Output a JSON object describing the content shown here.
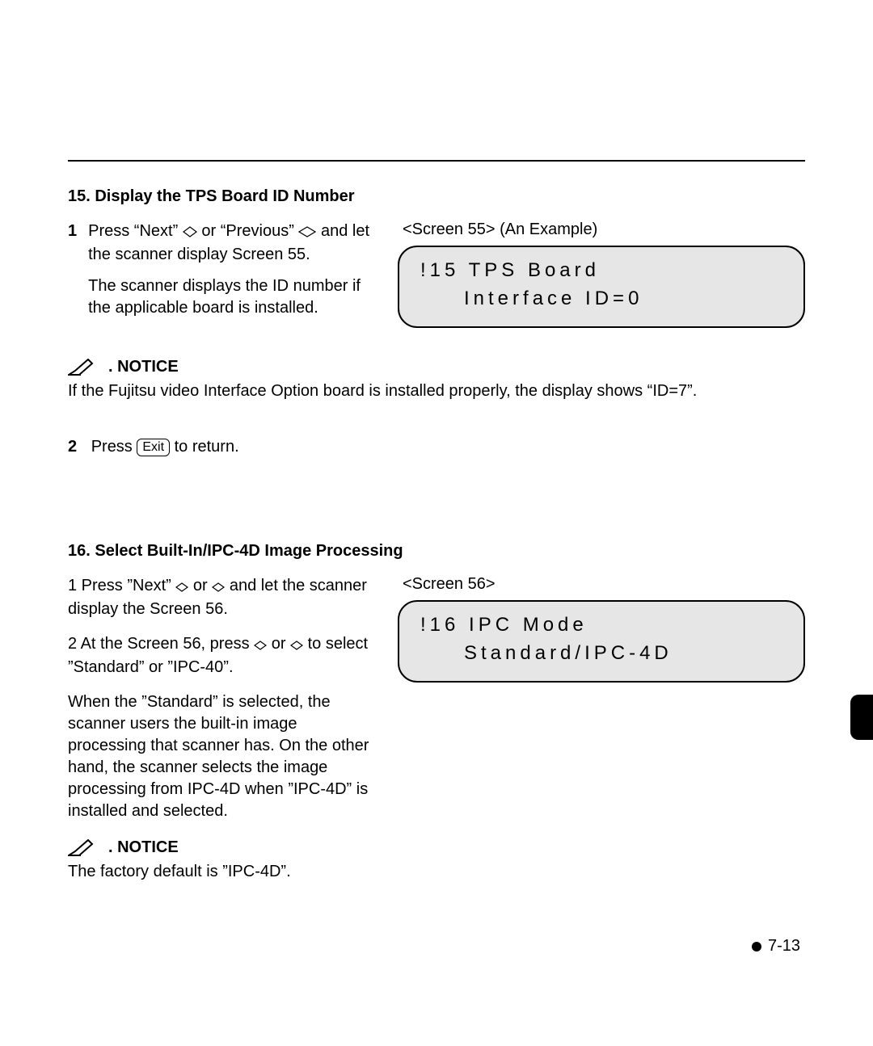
{
  "section15": {
    "heading": "15. Display the TPS Board ID Number",
    "step1_num": "1",
    "step1_a": "Press “Next” ",
    "step1_b": " or “Previous” ",
    "step1_c": " and let the scanner display Screen 55.",
    "step1_extra": "The scanner displays the ID number if the applicable board is installed.",
    "screen_label": "<Screen 55> (An Example)",
    "lcd_line1": "!15 TPS Board",
    "lcd_line2": "Interface ID=0",
    "notice_label": ". NOTICE",
    "notice_body": "If the Fujitsu video Interface Option board is installed properly, the display shows “ID=7”.",
    "step2_num": "2",
    "step2_a": "Press ",
    "step2_key": "Exit",
    "step2_b": " to return."
  },
  "section16": {
    "heading": "16. Select Built-In/IPC-4D Image Processing",
    "screen_label": "<Screen 56>",
    "para1_a": "1 Press ”Next” ",
    "para1_b": " or ",
    "para1_c": " and let the scanner display the Screen 56.",
    "para2_a": "2 At the Screen 56, press ",
    "para2_b": " or ",
    "para2_c": " to select ”Standard” or ”IPC-40”.",
    "para3": "When the ”Standard” is selected, the scanner users the built-in image processing that scanner has.  On the other hand, the scanner selects the image processing from IPC-4D when ”IPC-4D” is installed and selected.",
    "lcd_line1": "!16 IPC Mode",
    "lcd_line2": "Standard/IPC-4D",
    "notice_label": ". NOTICE",
    "notice_body": "The factory default is ”IPC-4D”."
  },
  "page_number": "7-13"
}
